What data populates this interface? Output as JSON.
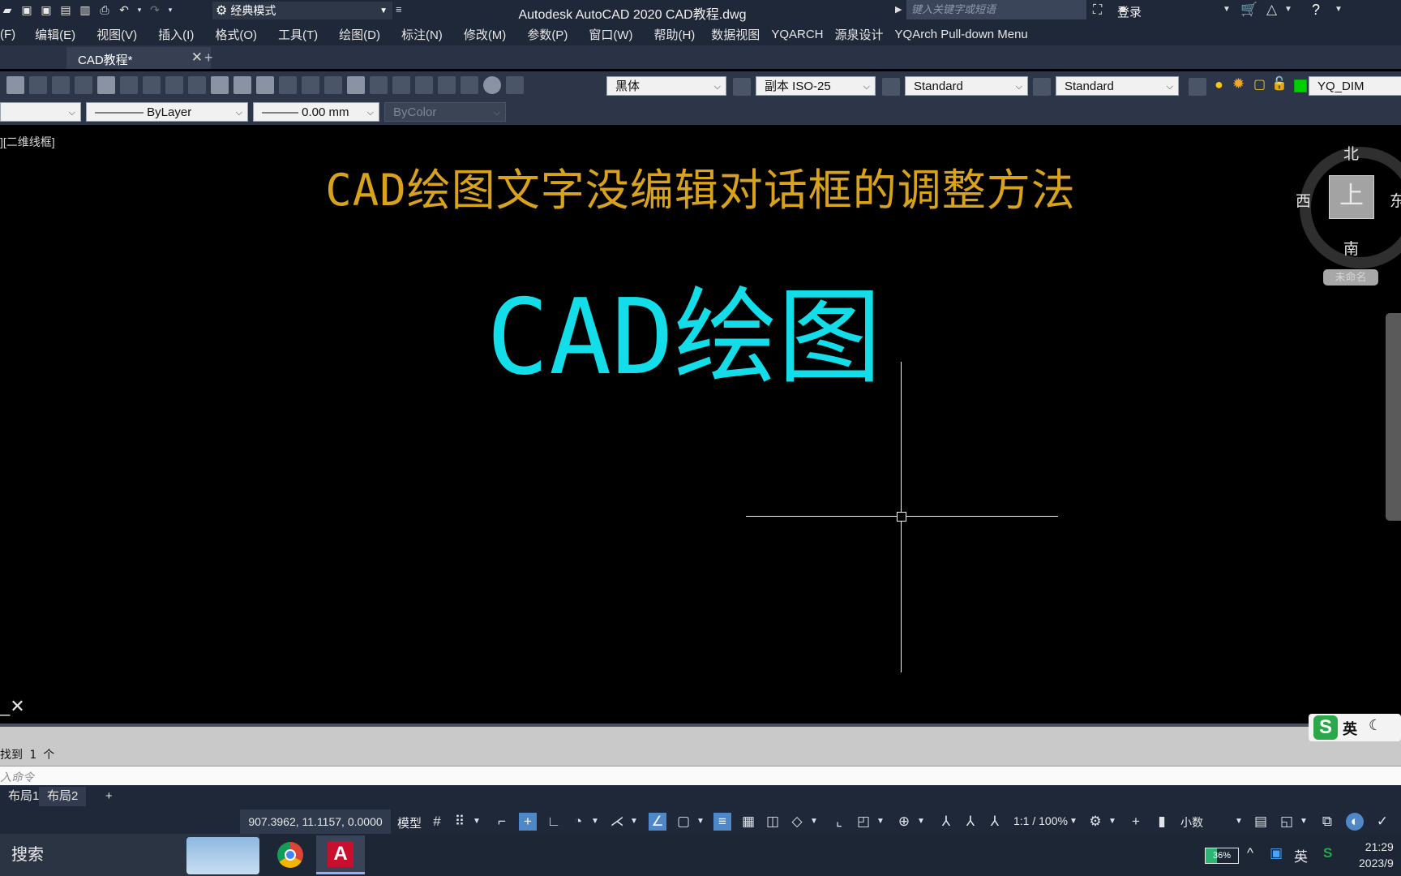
{
  "app": {
    "title": "Autodesk AutoCAD 2020    CAD教程.dwg",
    "workspace": "经典模式",
    "search_placeholder": "键入关键字或短语",
    "login": "登录"
  },
  "menu": [
    "(F)",
    "编辑(E)",
    "视图(V)",
    "插入(I)",
    "格式(O)",
    "工具(T)",
    "绘图(D)",
    "标注(N)",
    "修改(M)",
    "参数(P)",
    "窗口(W)",
    "帮助(H)",
    "数据视图",
    "YQARCH",
    "源泉设计",
    "YQArch Pull-down Menu"
  ],
  "tabs": {
    "doc_label": "CAD教程*",
    "close": "✕",
    "add": "+"
  },
  "toolbar": {
    "text_style": "黑体",
    "dim_style": "副本 ISO-25",
    "table_style": "Standard",
    "multileader_style": "Standard",
    "layer_name": "YQ_DIM",
    "linetype": "———— ByLayer",
    "lineweight": "——— 0.00 mm",
    "plot_style": "ByColor"
  },
  "viewport": {
    "label": "][二维线框]",
    "heading": "CAD绘图文字没编辑对话框的调整方法",
    "big_text": "CAD绘图"
  },
  "viewcube": {
    "north": "北",
    "south": "南",
    "west": "西",
    "east": "东",
    "face": "上",
    "ucs_name": "未命名"
  },
  "command": {
    "history": "找到 1 个",
    "placeholder": "入命令"
  },
  "ime": {
    "mode": "英"
  },
  "layout_tabs": [
    "布局1",
    "布局2",
    "+"
  ],
  "status": {
    "coords": "907.3962, 11.1157, 0.0000",
    "model": "模型",
    "scale": "1:1 / 100%",
    "units": "小数"
  },
  "taskbar": {
    "search": "搜索",
    "battery": "36%",
    "ime": "英",
    "time": "21:29",
    "date": "2023/9"
  }
}
